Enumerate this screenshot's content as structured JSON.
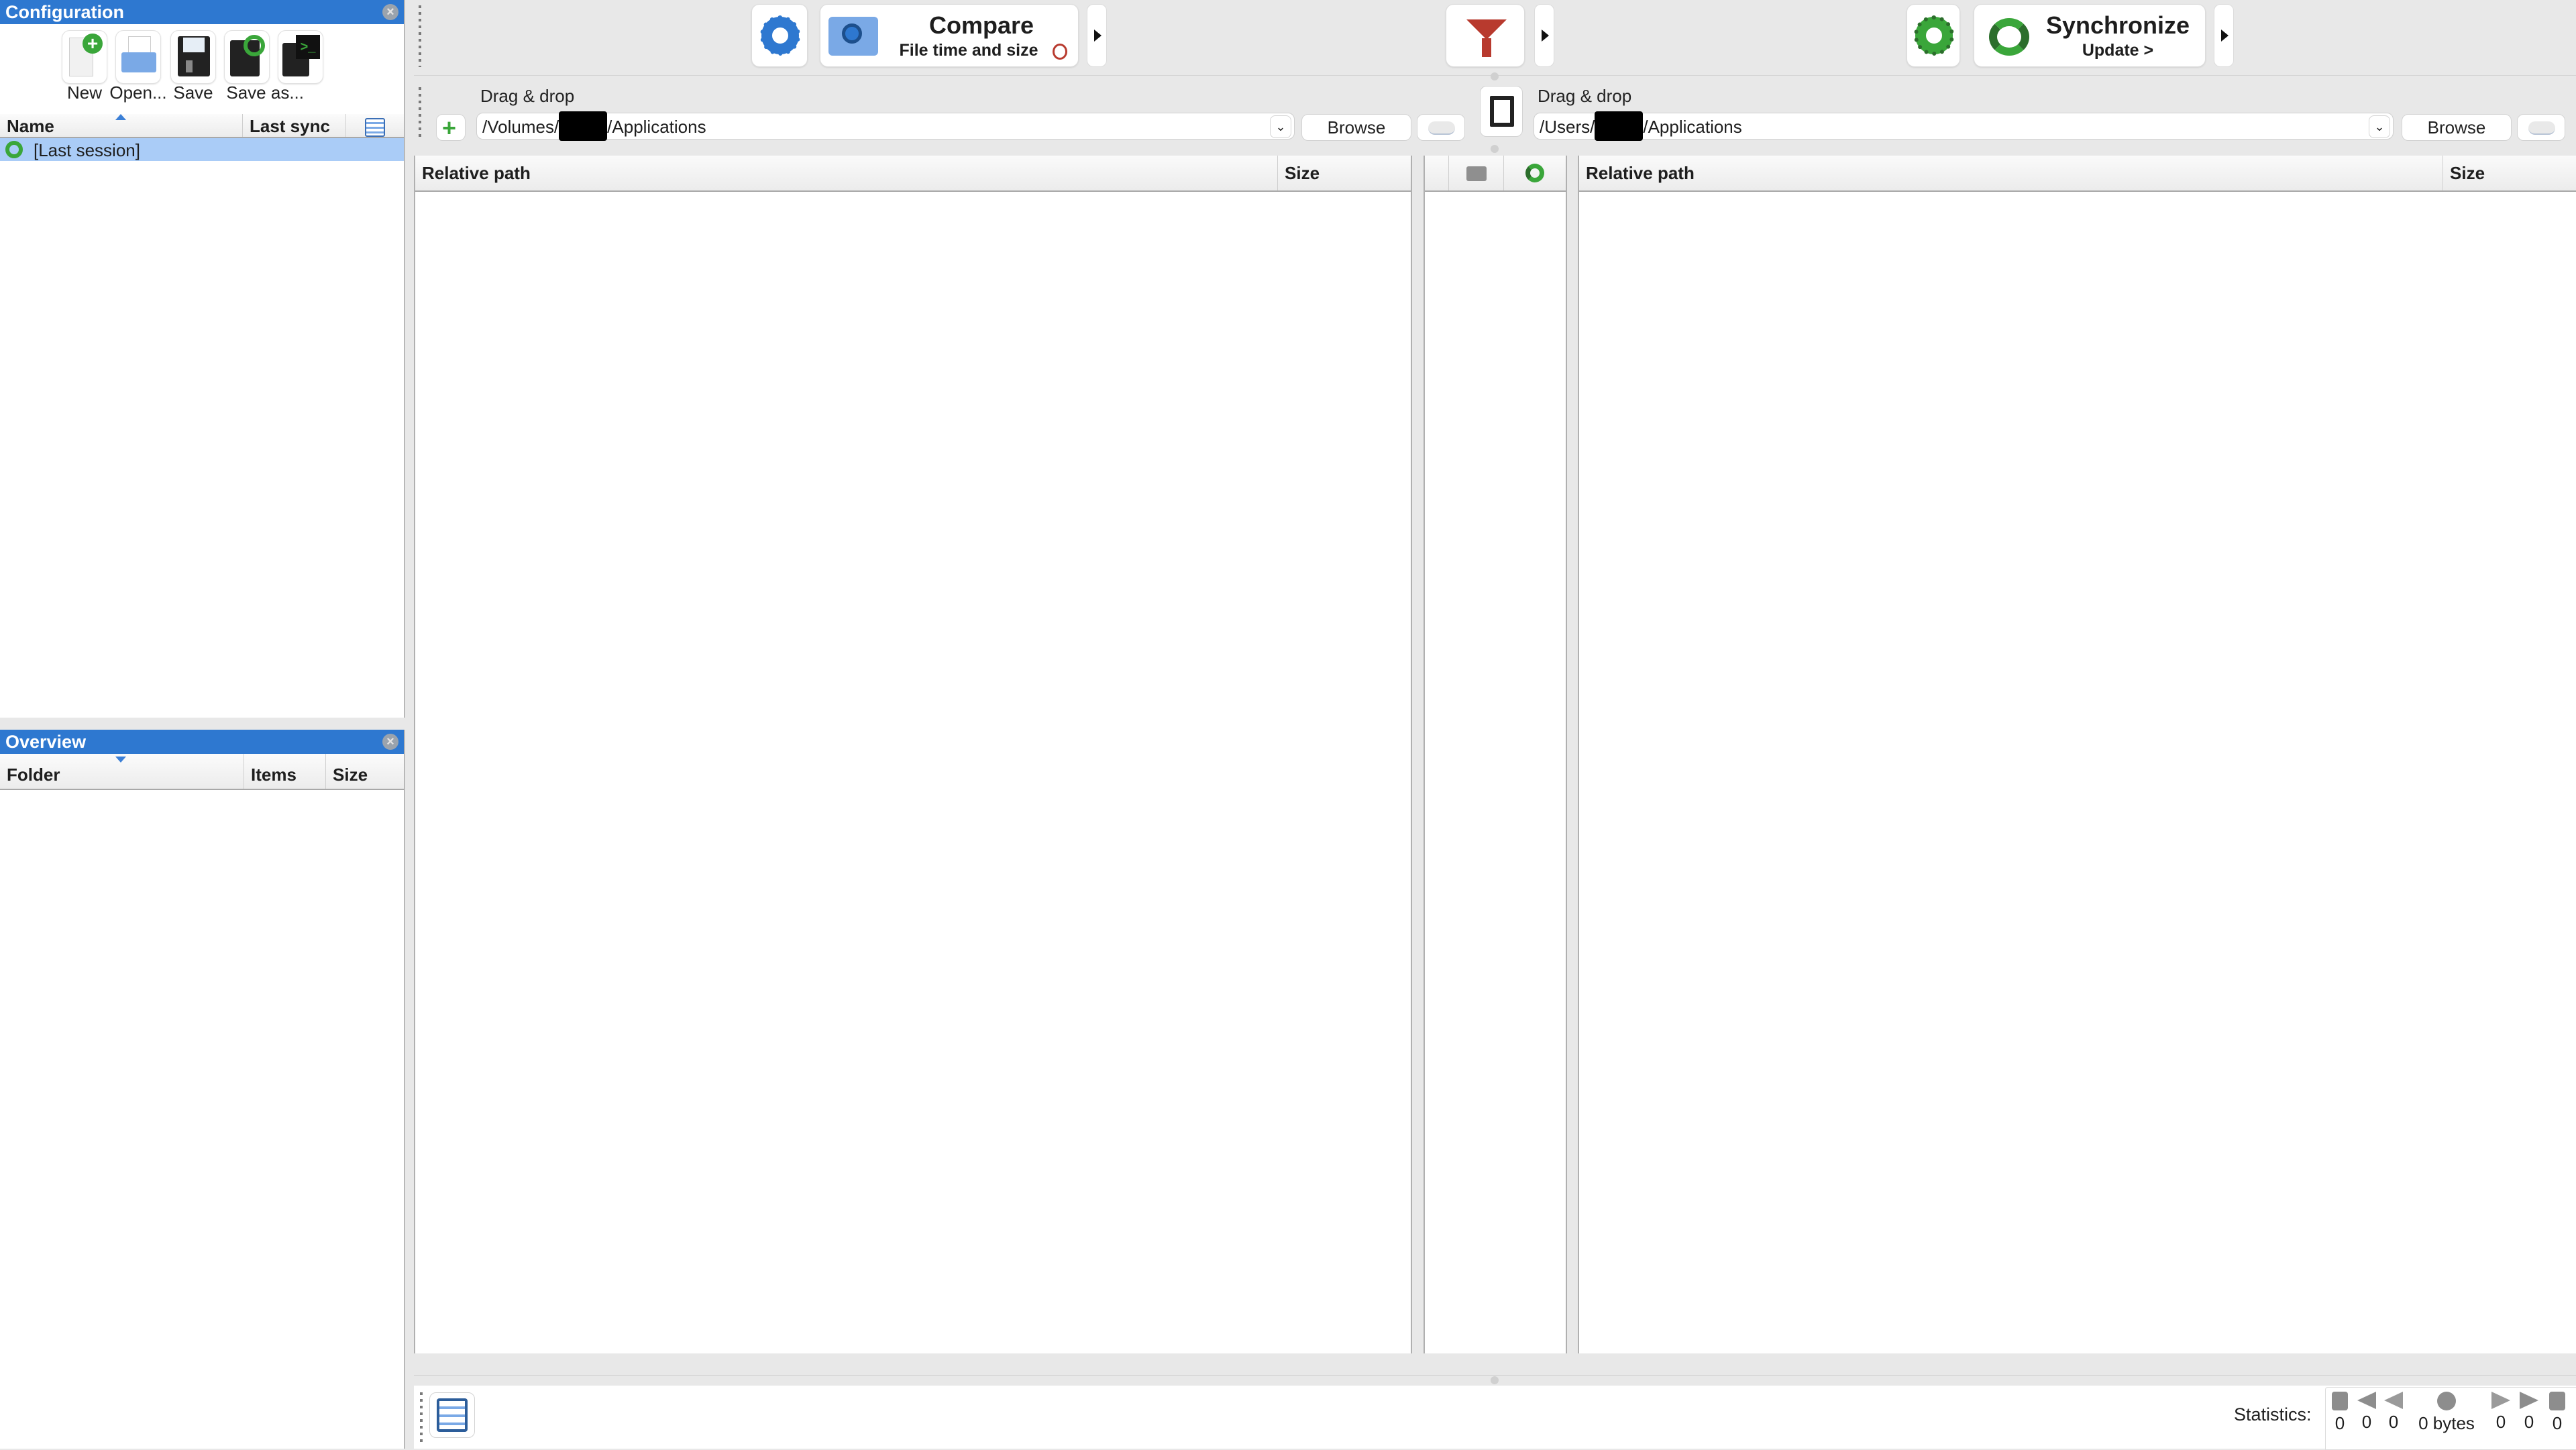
{
  "config_panel": {
    "title": "Configuration",
    "toolbar": [
      {
        "label": "New",
        "icon": "new-config-icon"
      },
      {
        "label": "Open...",
        "icon": "open-config-icon"
      },
      {
        "label": "Save",
        "icon": "save-icon"
      },
      {
        "label": "Save as...",
        "icon": "save-as-icon"
      },
      {
        "label": "",
        "icon": "save-as-batch-icon"
      }
    ],
    "columns": [
      "Name",
      "Last sync"
    ],
    "rows": [
      {
        "name": "[Last session]",
        "last_sync": "",
        "selected": true
      }
    ]
  },
  "overview_panel": {
    "title": "Overview",
    "columns": [
      "Folder",
      "Items",
      "Size"
    ],
    "rows": []
  },
  "toolbar": {
    "compare": {
      "title": "Compare",
      "subtitle": "File time and size"
    },
    "synchronize": {
      "title": "Synchronize",
      "subtitle": "Update >"
    }
  },
  "folders": {
    "left": {
      "drag_label": "Drag & drop",
      "path_prefix": "/Volumes/",
      "path_suffix": "/Applications",
      "browse_label": "Browse"
    },
    "right": {
      "drag_label": "Drag & drop",
      "path_prefix": "/Users/",
      "path_suffix": "/Applications",
      "browse_label": "Browse"
    }
  },
  "file_lists": {
    "left": {
      "columns": [
        "Relative path",
        "Size"
      ],
      "rows": []
    },
    "right": {
      "columns": [
        "Relative path",
        "Size"
      ],
      "rows": []
    }
  },
  "statistics": {
    "label": "Statistics:",
    "items": [
      {
        "icon": "delete-left-icon",
        "value": "0"
      },
      {
        "icon": "update-left-icon",
        "value": "0"
      },
      {
        "icon": "create-left-icon",
        "value": "0"
      },
      {
        "icon": "data-volume-icon",
        "value": "0 bytes"
      },
      {
        "icon": "create-right-icon",
        "value": "0"
      },
      {
        "icon": "update-right-icon",
        "value": "0"
      },
      {
        "icon": "delete-right-icon",
        "value": "0"
      }
    ]
  },
  "colors": {
    "accent": "#2e78d0",
    "selection": "#aaccf7",
    "sync_green": "#3aa63a",
    "filter_red": "#b83a2e"
  }
}
